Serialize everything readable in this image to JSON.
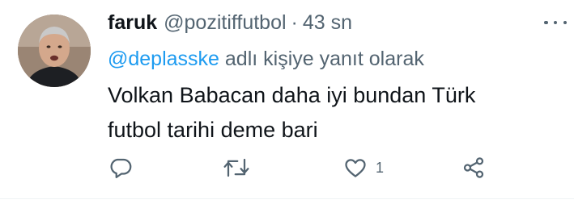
{
  "tweet": {
    "author_name": "faruk",
    "author_handle": "@pozitiffutbol",
    "separator": "·",
    "time": "43 sn",
    "reply_mention": "@deplasske",
    "reply_suffix": "adlı kişiye yanıt olarak",
    "text_line1": "Volkan Babacan daha iyi bundan Türk",
    "text_line2": "futbol tarihi deme bari"
  },
  "actions": {
    "reply_count": "",
    "retweet_count": "",
    "like_count": "1"
  },
  "icons": [
    "avatar-photo",
    "more-icon",
    "reply-icon",
    "retweet-icon",
    "like-icon",
    "share-icon"
  ],
  "colors": {
    "text": "#0f1419",
    "secondary": "#536471",
    "link": "#1d9bf0"
  }
}
